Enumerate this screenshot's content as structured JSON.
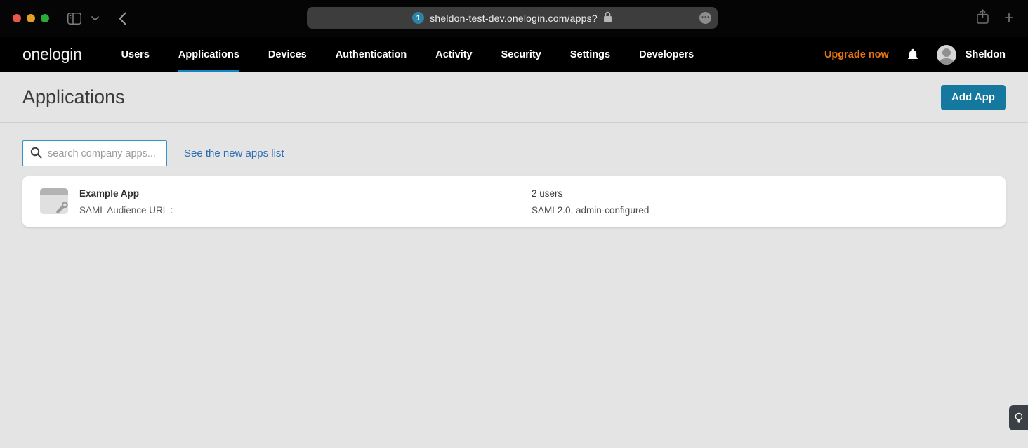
{
  "browser": {
    "tab_badge": "1",
    "url": "sheldon-test-dev.onelogin.com/apps?"
  },
  "navbar": {
    "logo": "onelogin",
    "items": [
      {
        "label": "Users",
        "active": false
      },
      {
        "label": "Applications",
        "active": true
      },
      {
        "label": "Devices",
        "active": false
      },
      {
        "label": "Authentication",
        "active": false
      },
      {
        "label": "Activity",
        "active": false
      },
      {
        "label": "Security",
        "active": false
      },
      {
        "label": "Settings",
        "active": false
      },
      {
        "label": "Developers",
        "active": false
      }
    ],
    "upgrade_label": "Upgrade now",
    "user_name": "Sheldon"
  },
  "page": {
    "title": "Applications",
    "add_app_label": "Add App"
  },
  "toolbar": {
    "search_placeholder": "search company apps...",
    "new_apps_link": "See the new apps list"
  },
  "apps": [
    {
      "name": "Example App",
      "subtitle": "SAML Audience URL :",
      "users": "2 users",
      "config": "SAML2.0, admin-configured"
    }
  ],
  "colors": {
    "nav_active_underline": "#1088c4",
    "add_app_button": "#15799f",
    "link_blue": "#2a6db3",
    "upgrade_orange": "#e87511",
    "search_border": "#2e96c6",
    "page_background": "#e4e4e4",
    "navbar_background": "#000000"
  }
}
